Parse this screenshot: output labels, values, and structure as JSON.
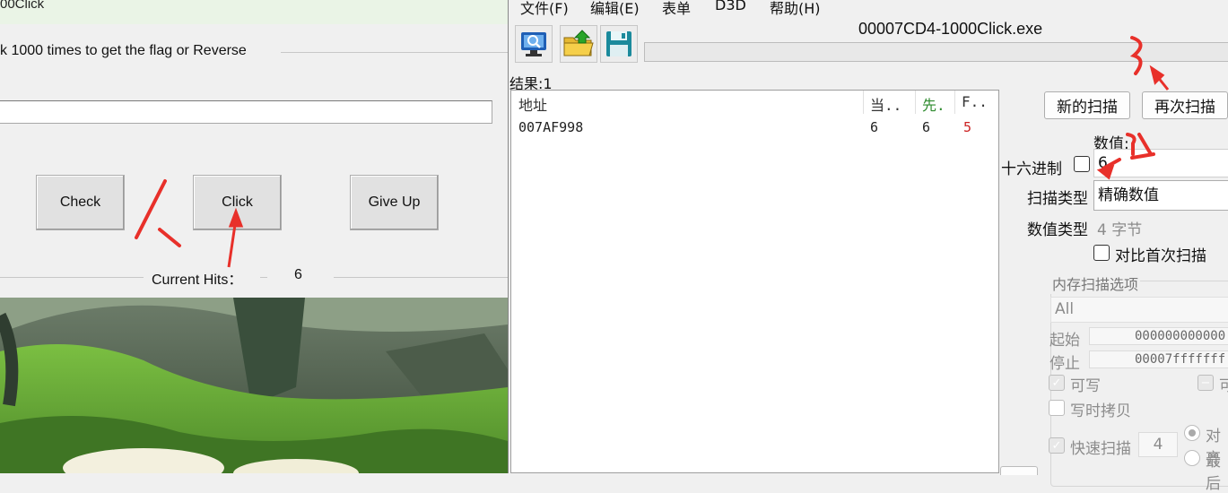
{
  "left_app": {
    "title": "00Click",
    "instruction": "k 1000 times to get the flag or Reverse",
    "input_value": "",
    "buttons": {
      "check": "Check",
      "click": "Click",
      "give_up": "Give Up"
    },
    "hits_label": "Current Hits：",
    "hits_value": "6"
  },
  "ce": {
    "menu": [
      "文件(F)",
      "编辑(E)",
      "表单",
      "D3D",
      "帮助(H)"
    ],
    "toolbar_icons": [
      "process-select-icon",
      "open-file-icon",
      "save-icon"
    ],
    "process_title": "00007CD4-1000Click.exe",
    "results_label": "结果:1",
    "list_headers": {
      "address": "地址",
      "current": "当..",
      "previous": "先.",
      "first": "F.."
    },
    "rows": [
      {
        "address": "007AF998",
        "current": "6",
        "previous": "6",
        "first": "5"
      }
    ],
    "colors": {
      "previous_header": "#2e8b2e",
      "first_value": "#cc2222"
    },
    "buttons": {
      "new_scan": "新的扫描",
      "next_scan": "再次扫描"
    },
    "value_label": "数值:",
    "hex_label": "十六进制",
    "value_input": "6",
    "scan_type_label": "扫描类型",
    "scan_type_value": "精确数值",
    "value_type_label": "数值类型",
    "value_type_value": "4 字节",
    "compare_first_label": "对比首次扫描",
    "mem_options": {
      "title": "内存扫描选项",
      "region": "All",
      "start_label": "起始",
      "start_value": "000000000000",
      "stop_label": "停止",
      "stop_value": "00007fffffff",
      "writable": "可写",
      "executable_partial": "可",
      "copy_on_write": "写时拷贝",
      "fast_scan": "快速扫描",
      "fast_scan_value": "4",
      "align_partial": "对齐",
      "last_partial": "最后"
    }
  },
  "annotations": {
    "step_1": "1",
    "step_3": "3"
  }
}
